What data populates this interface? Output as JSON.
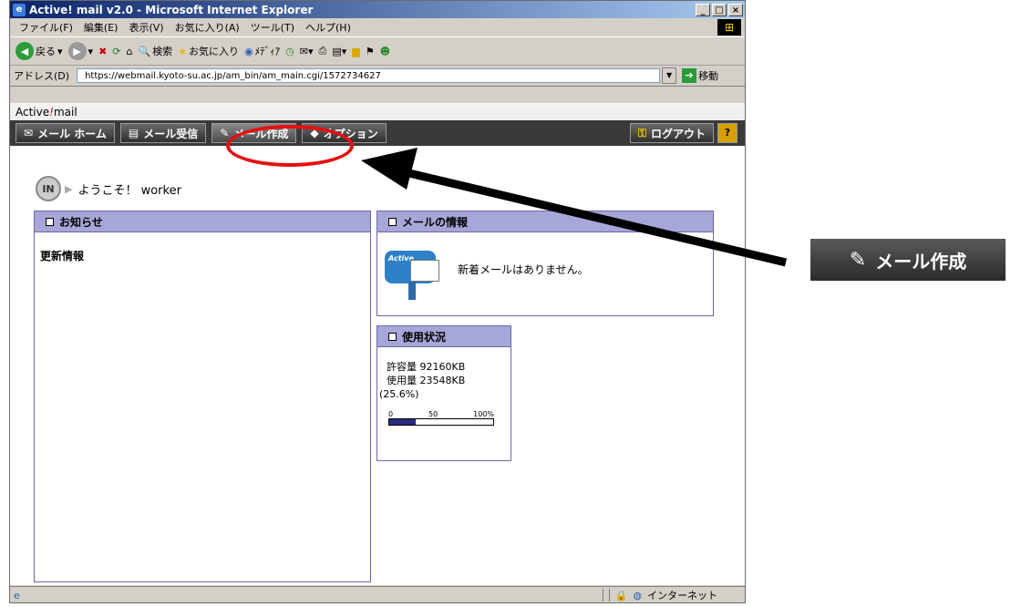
{
  "window": {
    "title": "Active! mail v2.0 - Microsoft Internet Explorer",
    "controls": [
      "_",
      "□",
      "×"
    ]
  },
  "menubar": [
    "ファイル(F)",
    "編集(E)",
    "表示(V)",
    "お気に入り(A)",
    "ツール(T)",
    "ヘルプ(H)"
  ],
  "toolbar": {
    "back": "戻る",
    "search": "検索",
    "favorites": "お気に入り",
    "media": "ﾒﾃﾞｨｱ"
  },
  "address": {
    "label": "アドレス(D)",
    "url": "https://webmail.kyoto-su.ac.jp/am_bin/am_main.cgi/1572734627",
    "go": "移動"
  },
  "app": {
    "logo_left": "Active",
    "logo_slash": "!",
    "logo_right": "mail",
    "nav": {
      "home": "メール ホーム",
      "receive": "メール受信",
      "compose": "メール作成",
      "options": "オプション",
      "logout": "ログアウト",
      "help": "?"
    },
    "welcome": {
      "badge": "IN",
      "text": "ようこそ！ worker"
    }
  },
  "panels": {
    "notice": {
      "title": "お知らせ",
      "news_title": "更新情報"
    },
    "mail_info": {
      "title": "メールの情報",
      "message": "新着メールはありません。",
      "icon_text": "Active"
    },
    "usage": {
      "title": "使用状況",
      "capacity": "許容量 92160KB",
      "used": "使用量 23548KB",
      "percent": "(25.6%)",
      "percent_value": 25.6,
      "scale": [
        "0",
        "50",
        "100%"
      ]
    }
  },
  "statusbar": {
    "zone": "インターネット"
  },
  "callout": {
    "label": "メール作成"
  }
}
